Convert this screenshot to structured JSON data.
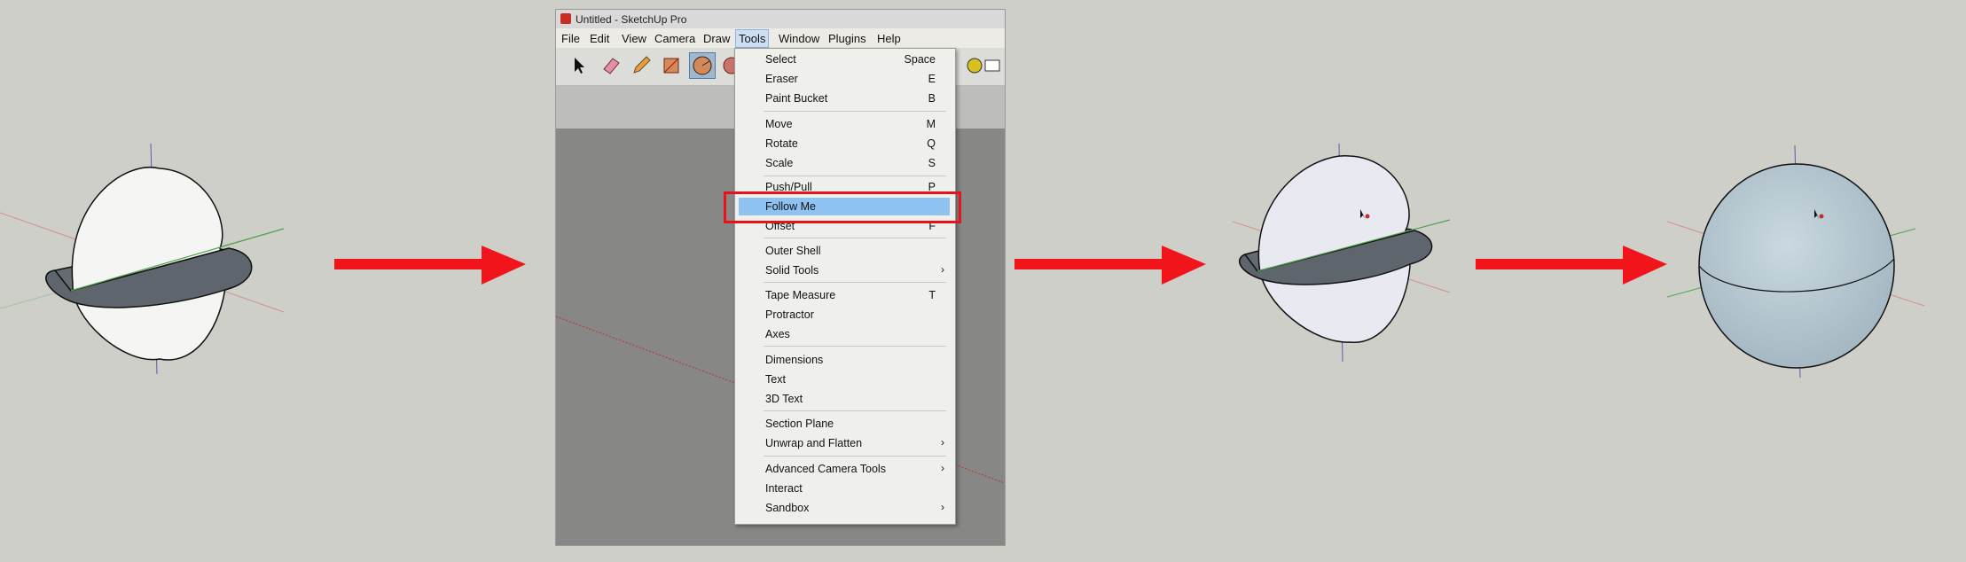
{
  "window": {
    "title": "Untitled - SketchUp Pro",
    "menubar": [
      "File",
      "Edit",
      "View",
      "Camera",
      "Draw",
      "Tools",
      "Window",
      "Plugins",
      "Help"
    ],
    "active_menu": "Tools"
  },
  "tools_menu": {
    "items": [
      {
        "label": "Select",
        "shortcut": "Space"
      },
      {
        "label": "Eraser",
        "shortcut": "E"
      },
      {
        "label": "Paint Bucket",
        "shortcut": "B"
      },
      {
        "label": "Move",
        "shortcut": "M"
      },
      {
        "label": "Rotate",
        "shortcut": "Q"
      },
      {
        "label": "Scale",
        "shortcut": "S"
      },
      {
        "label": "Push/Pull",
        "shortcut": "P"
      },
      {
        "label": "Follow Me",
        "shortcut": ""
      },
      {
        "label": "Offset",
        "shortcut": "F"
      },
      {
        "label": "Outer Shell",
        "shortcut": ""
      },
      {
        "label": "Solid Tools",
        "shortcut": "›"
      },
      {
        "label": "Tape Measure",
        "shortcut": "T"
      },
      {
        "label": "Protractor",
        "shortcut": ""
      },
      {
        "label": "Axes",
        "shortcut": ""
      },
      {
        "label": "Dimensions",
        "shortcut": ""
      },
      {
        "label": "Text",
        "shortcut": ""
      },
      {
        "label": "3D Text",
        "shortcut": ""
      },
      {
        "label": "Section Plane",
        "shortcut": ""
      },
      {
        "label": "Unwrap and Flatten",
        "shortcut": "›"
      },
      {
        "label": "Advanced Camera Tools",
        "shortcut": "›"
      },
      {
        "label": "Interact",
        "shortcut": ""
      },
      {
        "label": "Sandbox",
        "shortcut": "›"
      }
    ],
    "highlighted": "Follow Me"
  },
  "toolbar_icons": [
    "select-arrow-icon",
    "eraser-icon",
    "pencil-icon",
    "rectangle-icon",
    "circle-icon",
    "shape-icon"
  ],
  "colors": {
    "background": "#cfcfca",
    "arrow": "#f2141b",
    "highlight_box": "#e8121b",
    "menu_highlight": "#8ec2f2",
    "disk_fill": "#646a70",
    "sphere_fill": "#b9ccd6"
  }
}
